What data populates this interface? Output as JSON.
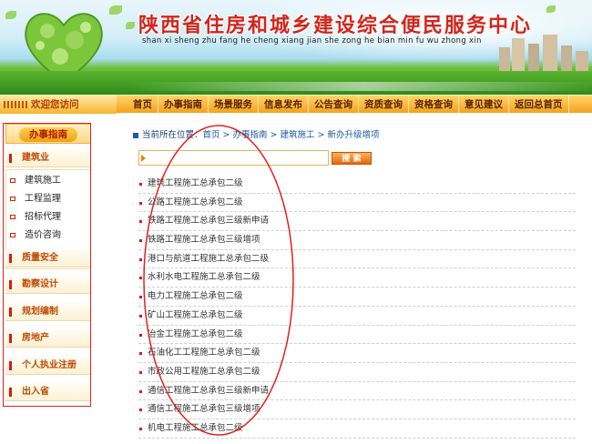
{
  "header": {
    "title": "陕西省住房和城乡建设综合便民服务中心",
    "pinyin": "shan xi sheng zhu fang he cheng xiang jian she zong he bian min fu wu zhong xin"
  },
  "navbar": {
    "welcome": "欢迎您访问",
    "items": [
      "首页",
      "办事指南",
      "场景服务",
      "信息发布",
      "公告查询",
      "资质查询",
      "资格查询",
      "意见建议",
      "返回总首页"
    ]
  },
  "sidebar": {
    "header": "办事指南",
    "groups": [
      {
        "label": "建筑业"
      },
      {
        "label": "质量安全"
      },
      {
        "label": "勘察设计"
      },
      {
        "label": "规划编制"
      },
      {
        "label": "房地产"
      },
      {
        "label": "个人执业注册"
      },
      {
        "label": "出入省"
      }
    ],
    "sub_items": [
      "建筑施工",
      "工程监理",
      "招标代理",
      "造价咨询"
    ]
  },
  "breadcrumb": {
    "label": "当前所在位置：",
    "path": "首页 > 办事指南 > 建筑施工 > 新办升级增项"
  },
  "search": {
    "value": "",
    "button": "搜 索"
  },
  "list": [
    "建筑工程施工总承包二级",
    "公路工程施工总承包二级",
    "铁路工程施工总承包三级新申请",
    "铁路工程施工总承包三级增项",
    "港口与航道工程施工总承包二级",
    "水利水电工程施工总承包二级",
    "电力工程施工总承包二级",
    "矿山工程施工总承包二级",
    "冶金工程施工总承包二级",
    "石油化工工程施工总承包二级",
    "市政公用工程施工总承包二级",
    "通信工程施工总承包三级新申请",
    "通信工程施工总承包三级增项",
    "机电工程施工总承包二级"
  ],
  "colors": {
    "title_red": "#d2261c",
    "nav_orange": "#f3a21c",
    "link_blue": "#1b5ba7",
    "annotation_red": "#e02020"
  }
}
